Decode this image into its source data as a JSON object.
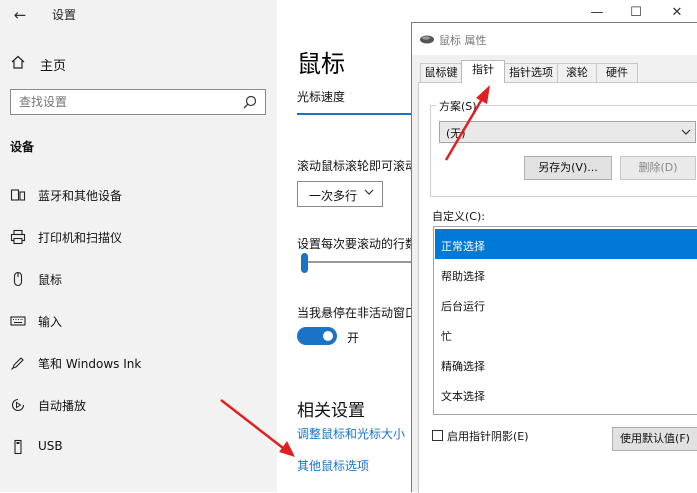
{
  "settings": {
    "app_title": "设置",
    "home": "主页",
    "search_placeholder": "查找设置",
    "section": "设备",
    "nav": [
      {
        "label": "蓝牙和其他设备",
        "icon": "bluetooth-device-icon"
      },
      {
        "label": "打印机和扫描仪",
        "icon": "printer-icon"
      },
      {
        "label": "鼠标",
        "icon": "mouse-icon"
      },
      {
        "label": "输入",
        "icon": "keyboard-icon"
      },
      {
        "label": "笔和 Windows Ink",
        "icon": "pen-icon"
      },
      {
        "label": "自动播放",
        "icon": "autoplay-icon"
      },
      {
        "label": "USB",
        "icon": "usb-icon"
      }
    ]
  },
  "content": {
    "title": "鼠标",
    "tab": "光标速度",
    "scroll_label": "滚动鼠标滚轮即可滚动",
    "scroll_value": "一次多行",
    "lines_label": "设置每次要滚动的行数",
    "hover_label": "当我悬停在非活动窗口",
    "hover_state": "开",
    "related_heading": "相关设置",
    "link_adjust": "调整鼠标和光标大小",
    "link_other": "其他鼠标选项"
  },
  "dialog": {
    "title": "鼠标 属性",
    "tabs": [
      "鼠标键",
      "指针",
      "指针选项",
      "滚轮",
      "硬件"
    ],
    "scheme_label": "方案(S)",
    "scheme_value": "(无)",
    "save_as": "另存为(V)...",
    "delete": "删除(D)",
    "custom_label": "自定义(C):",
    "cursors": [
      "正常选择",
      "帮助选择",
      "后台运行",
      "忙",
      "精确选择",
      "文本选择"
    ],
    "shadow_label": "启用指针阴影(E)",
    "use_default": "使用默认值(F)"
  },
  "colors": {
    "accent": "#0078d7",
    "link": "#1a73c6",
    "annotation_arrow": "#e02020"
  }
}
